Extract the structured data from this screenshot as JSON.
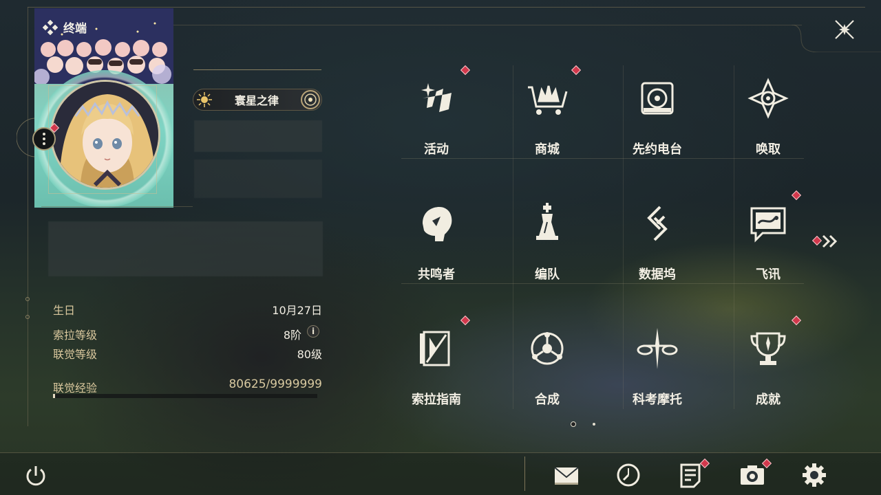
{
  "header": {
    "title": "终端"
  },
  "profile": {
    "name_plate": "寰星之律",
    "stats": {
      "birthday_label": "生日",
      "birthday_value": "10月27日",
      "sola_level_label": "索拉等级",
      "sola_level_value": "8阶",
      "union_level_label": "联觉等级",
      "union_level_value": "80级",
      "union_exp_label": "联觉经验",
      "union_exp_value": "80625/9999999",
      "union_exp_progress": 0.008
    },
    "info_icon": "i"
  },
  "menu": {
    "items": [
      {
        "label": "活动",
        "icon": "activity-icon",
        "badge": true
      },
      {
        "label": "商城",
        "icon": "shop-icon",
        "badge": true
      },
      {
        "label": "先约电台",
        "icon": "radio-icon",
        "badge": false
      },
      {
        "label": "唤取",
        "icon": "convene-icon",
        "badge": false
      },
      {
        "label": "共鸣者",
        "icon": "resonator-icon",
        "badge": false
      },
      {
        "label": "编队",
        "icon": "team-icon",
        "badge": false
      },
      {
        "label": "数据坞",
        "icon": "data-bank-icon",
        "badge": false
      },
      {
        "label": "飞讯",
        "icon": "message-icon",
        "badge": true
      },
      {
        "label": "索拉指南",
        "icon": "guidebook-icon",
        "badge": true
      },
      {
        "label": "合成",
        "icon": "synthesis-icon",
        "badge": false
      },
      {
        "label": "科考摩托",
        "icon": "motorbike-icon",
        "badge": false
      },
      {
        "label": "成就",
        "icon": "achievement-icon",
        "badge": true
      }
    ],
    "current_page": 1,
    "page_count": 2
  },
  "bottom_bar": {
    "icons": [
      "mail-icon",
      "clock-icon",
      "notice-icon",
      "camera-icon",
      "settings-icon"
    ]
  },
  "colors": {
    "accent_gold": "#d9c79d",
    "badge_red": "#d2384c",
    "text": "#f3efe4"
  }
}
